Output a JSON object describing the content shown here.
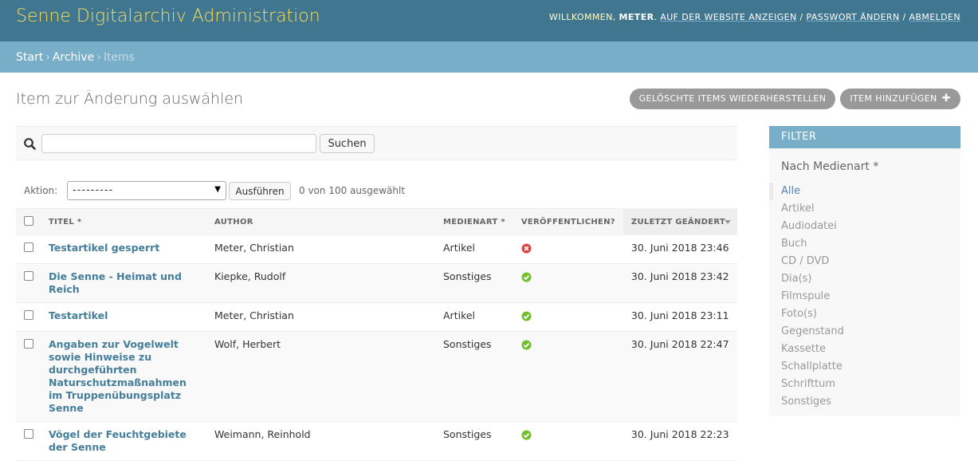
{
  "header": {
    "site_name": "Senne Digitalarchiv Administration",
    "welcome": "Willkommen,",
    "username": "Meter",
    "view_site": "Auf der Website anzeigen",
    "password_change": "Passwort ändern",
    "logout": "Abmelden"
  },
  "breadcrumbs": {
    "home": "Start",
    "app": "Archive",
    "current": "Items",
    "separator": "›"
  },
  "page": {
    "title": "Item zur Änderung auswählen",
    "recover_button": "Gelöschte Items wiederherstellen",
    "add_button": "Item hinzufügen"
  },
  "search": {
    "value": "",
    "button": "Suchen"
  },
  "actions": {
    "label": "Aktion:",
    "selected": "---------",
    "go_button": "Ausführen",
    "counter": "0 von 100 ausgewählt"
  },
  "table": {
    "columns": [
      "Titel",
      "Author",
      "Medienart",
      "Veröffentlichen?",
      "Zuletzt geändert"
    ],
    "sort_marks": [
      "*",
      "",
      "*",
      "",
      ""
    ],
    "rows": [
      {
        "title": "Testartikel gesperrt",
        "author": "Meter, Christian",
        "medium": "Artikel",
        "published": false,
        "modified": "30. Juni 2018 23:46"
      },
      {
        "title": "Die Senne - Heimat und Reich",
        "author": "Kiepke, Rudolf",
        "medium": "Sonstiges",
        "published": true,
        "modified": "30. Juni 2018 23:42"
      },
      {
        "title": "Testartikel",
        "author": "Meter, Christian",
        "medium": "Artikel",
        "published": true,
        "modified": "30. Juni 2018 23:11"
      },
      {
        "title": "Angaben zur Vogelwelt sowie Hinweise zu durchgeführten Naturschutzmaßnahmen im Truppenübungsplatz Senne",
        "author": "Wolf, Herbert",
        "medium": "Sonstiges",
        "published": true,
        "modified": "30. Juni 2018 22:47"
      },
      {
        "title": "Vögel der Feuchtgebiete der Senne",
        "author": "Weimann, Reinhold",
        "medium": "Sonstiges",
        "published": true,
        "modified": "30. Juni 2018 22:23"
      }
    ]
  },
  "filter": {
    "heading": "Filter",
    "section_title": "Nach Medienart",
    "section_mark": "*",
    "items": [
      "Alle",
      "Artikel",
      "Audiodatei",
      "Buch",
      "CD / DVD",
      "Dia(s)",
      "Filmspule",
      "Foto(s)",
      "Gegenstand",
      "Kassette",
      "Schallplatte",
      "Schrifttum",
      "Sonstiges"
    ],
    "selected_index": 0
  },
  "colors": {
    "header_bg": "#417690",
    "breadcrumbs_bg": "#79aec8",
    "site_name": "#f5dd5d",
    "link": "#447e9b",
    "yes": "#70bf2b",
    "no": "#dd4646"
  }
}
